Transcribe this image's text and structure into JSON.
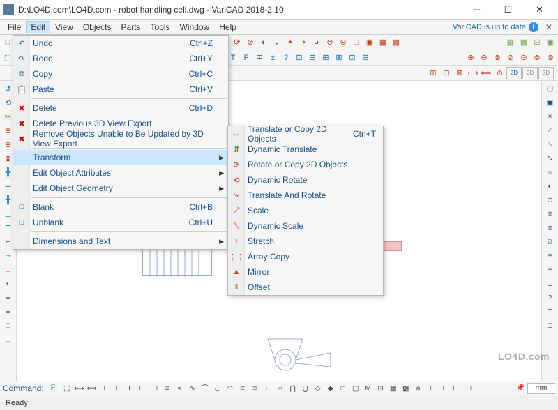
{
  "title": "D:\\LO4D.com\\LO4D.com - robot handling cell.dwg - VariCAD 2018-2.10",
  "menubar": {
    "items": [
      "File",
      "Edit",
      "View",
      "Objects",
      "Parts",
      "Tools",
      "Window",
      "Help"
    ],
    "active_index": 1,
    "status_text": "VariCAD is up to date"
  },
  "edit_menu": [
    {
      "icon": "↶",
      "label": "Undo",
      "shortcut": "Ctrl+Z"
    },
    {
      "icon": "↷",
      "label": "Redo",
      "shortcut": "Ctrl+Y"
    },
    {
      "icon": "⧉",
      "label": "Copy",
      "shortcut": "Ctrl+C"
    },
    {
      "icon": "📋",
      "label": "Paste",
      "shortcut": "Ctrl+V"
    },
    {
      "sep": true
    },
    {
      "icon": "✖",
      "label": "Delete",
      "shortcut": "Ctrl+D",
      "icon_color": "#c00"
    },
    {
      "icon": "✖",
      "label": "Delete Previous 3D View Export",
      "icon_color": "#c00"
    },
    {
      "icon": "✖",
      "label": "Remove Objects Unable to Be Updated by 3D View Export",
      "icon_color": "#c00"
    },
    {
      "sep": true
    },
    {
      "icon": "",
      "label": "Transform",
      "submenu": true,
      "highlight": true
    },
    {
      "icon": "",
      "label": "Edit Object Attributes",
      "submenu": true
    },
    {
      "icon": "",
      "label": "Edit Object Geometry",
      "submenu": true
    },
    {
      "sep": true
    },
    {
      "icon": "□",
      "label": "Blank",
      "shortcut": "Ctrl+B"
    },
    {
      "icon": "□",
      "label": "Unblank",
      "shortcut": "Ctrl+U"
    },
    {
      "sep": true
    },
    {
      "icon": "",
      "label": "Dimensions and Text",
      "submenu": true
    }
  ],
  "transform_submenu": [
    {
      "icon": "↔",
      "label": "Translate or Copy 2D Objects",
      "shortcut": "Ctrl+T"
    },
    {
      "icon": "⇵",
      "label": "Dynamic Translate"
    },
    {
      "icon": "⟳",
      "label": "Rotate or Copy 2D Objects"
    },
    {
      "icon": "⟲",
      "label": "Dynamic Rotate"
    },
    {
      "icon": "⤷",
      "label": "Translate And Rotate"
    },
    {
      "icon": "⤢",
      "label": "Scale"
    },
    {
      "icon": "⤡",
      "label": "Dynamic Scale"
    },
    {
      "icon": "↕",
      "label": "Stretch"
    },
    {
      "icon": "⋮⋮",
      "label": "Array Copy"
    },
    {
      "icon": "▲",
      "label": "Mirror"
    },
    {
      "icon": "‖",
      "label": "Offset"
    }
  ],
  "command_bar": {
    "label": "Command:",
    "unit": "mm"
  },
  "statusbar": {
    "text": "Ready"
  },
  "watermark": "LO4D.com",
  "icons": {
    "toolbar_generic": [
      "◔",
      "◑",
      "®",
      "◎",
      "◉",
      "⊕",
      "⊗",
      "≈",
      "⊙",
      "⟳",
      "⊘",
      "◐",
      "◒",
      "◓",
      "◔",
      "◕",
      "⊜",
      "⊝",
      "□",
      "▣",
      "▦",
      "▩"
    ],
    "toolbar2": [
      "⬚",
      "⬓",
      "⬔",
      "≡",
      "⋄",
      "≋",
      "≈",
      "≡",
      "⊥",
      "T",
      "T",
      "T",
      "⟷",
      "⟺",
      "⫘",
      "⫙",
      "T",
      "T",
      "F",
      "∓",
      "±",
      "?",
      "⊡",
      "⊟",
      "⊞",
      "⊠",
      "⊡",
      "⊟"
    ],
    "toolbar3": [
      "⊞",
      "⊟",
      "⊠",
      "⟷",
      "⟺",
      "⫛"
    ],
    "left": [
      "↺",
      "⟲",
      "✂",
      "⊕",
      "⊖",
      "⊗",
      "╬",
      "╪",
      "╫",
      "⊥",
      "⊤",
      "⌐",
      "¬",
      "⌙",
      "◐",
      "≡",
      "≡",
      "□",
      "□"
    ],
    "right": [
      "▢",
      "▣",
      "×",
      "⟋",
      "⟍",
      "∿",
      "○",
      "◐",
      "⊙",
      "⊕",
      "⊖",
      "⧉",
      "≡",
      "≡",
      "⊥",
      "?",
      "T",
      "⊡"
    ],
    "cmdbar": [
      "⬚",
      "⟷",
      "⟺",
      "⊥",
      "⊤",
      "I",
      "⊢",
      "⊣",
      "≡",
      "≈",
      "∿",
      "⌒",
      "◡",
      "◠",
      "⊂",
      "⊃",
      "∪",
      "∩",
      "⋂",
      "⋃",
      "◇",
      "◆",
      "□",
      "▢",
      "M",
      "⊡",
      "▦",
      "▩",
      "a",
      "⊥",
      "⊤",
      "⊢",
      "⊣"
    ]
  }
}
